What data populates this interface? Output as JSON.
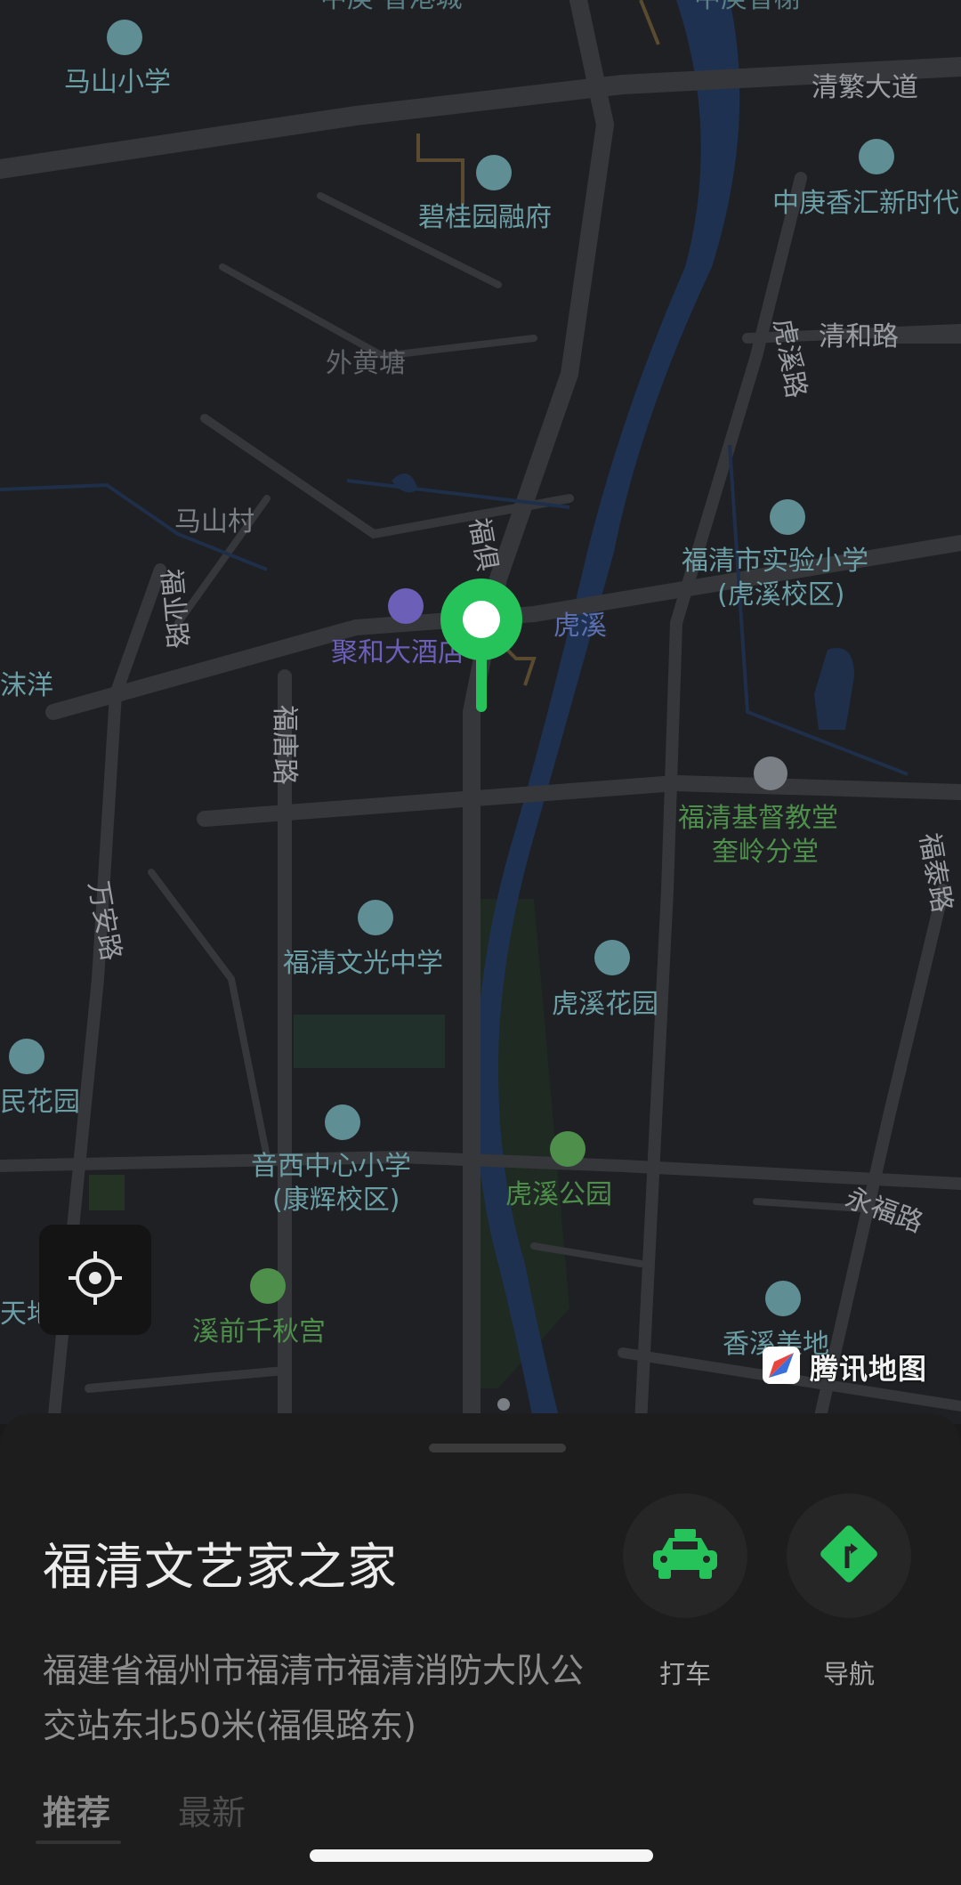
{
  "colors": {
    "map_background": "#1e2023",
    "road": "#35373b",
    "river": "#1f3150",
    "accent_green": "#25c35a",
    "label_gray": "#7a7f85",
    "label_teal": "#6c9ea6",
    "label_green": "#4e8f4b",
    "label_purple": "#6b5fb7"
  },
  "map": {
    "labels": {
      "mashan_school": "马山小学",
      "qingfan_road": "清繁大道",
      "biguiyuan": "碧桂园融府",
      "zhonggeng": "中庚香汇新时代",
      "huxi_road": "虎溪路",
      "qinghe_road": "清和路",
      "waihuangtang": "外黄塘",
      "mashan_village": "马山村",
      "fuju_road": "福俱",
      "fuye_road": "福业路",
      "huxi": "虎溪",
      "juhe_hotel": "聚和大酒店",
      "shiyan_school": "福清市实验小学",
      "shiyan_campus": "(虎溪校区)",
      "yang": "沫洋",
      "futang_road": "福唐路",
      "church": "福清基督教堂",
      "church_branch": "奎岭分堂",
      "wanan_road": "万安路",
      "futai_road": "福泰路",
      "wenguang_school": "福清文光中学",
      "huxi_garden": "虎溪花园",
      "min_garden": "民花园",
      "yinxi_school": "音西中心小学",
      "yinxi_campus": "(康辉校区)",
      "huxi_park": "虎溪公园",
      "yongfu_road": "永福路",
      "qianqiu_palace": "溪前千秋宫",
      "xiangxi": "香溪美地",
      "tian": "天地",
      "top_left": "中庚·香港城",
      "top_right": "中庚香榭"
    },
    "icons": {
      "school": "school-icon",
      "building": "building-icon",
      "hotel": "hotel-icon",
      "temple": "temple-icon",
      "park": "park-icon",
      "transit": "bus-stop-icon",
      "pin": "location-pin-icon"
    }
  },
  "locate_button": {
    "icon": "locate-me-icon"
  },
  "brand": {
    "name": "腾讯地图"
  },
  "place": {
    "title": "福清文艺家之家",
    "address": "福建省福州市福清市福清消防大队公交站东北50米(福俱路东)"
  },
  "actions": [
    {
      "label": "打车",
      "icon": "taxi-icon"
    },
    {
      "label": "导航",
      "icon": "navigation-icon"
    }
  ],
  "tabs": [
    {
      "label": "推荐"
    },
    {
      "label": "最新"
    }
  ]
}
